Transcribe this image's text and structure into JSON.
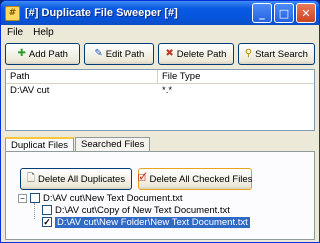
{
  "window": {
    "title": "[#] Duplicate File Sweeper [#]"
  },
  "title_buttons": {
    "minimize": "_",
    "maximize": "□",
    "close": "✕"
  },
  "menu": {
    "items": [
      "File",
      "Help"
    ]
  },
  "toolbar": {
    "add_path": "Add Path",
    "edit_path": "Edit Path",
    "delete_path": "Delete Path",
    "start_search": "Start Search"
  },
  "path_table": {
    "columns": [
      "Path",
      "File Type"
    ],
    "rows": [
      {
        "path": "D:\\AV cut",
        "file_type": "*.*"
      }
    ]
  },
  "tabs": [
    "Duplicat Files",
    "Searched Files"
  ],
  "duplicates": {
    "delete_all_label": "Delete All Duplicates",
    "delete_checked_label": "Delete All Checked Files",
    "tree": {
      "root": "D:\\AV cut\\New Text Document.txt",
      "children": [
        {
          "label": "D:\\AV cut\\Copy of New Text Document.txt",
          "checked": false
        },
        {
          "label": "D:\\AV cut\\New Folder\\New Text Document.txt",
          "checked": true
        }
      ]
    }
  },
  "colors": {
    "title_blue": "#0a5ae3",
    "window_bg": "#ece9d8",
    "selection": "#316ac5"
  }
}
